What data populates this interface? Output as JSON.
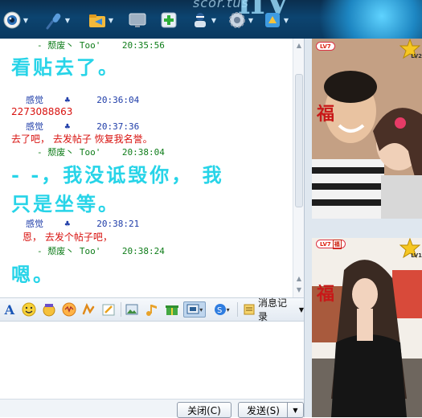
{
  "toolbar": {
    "brand_text": "scor.tus",
    "brand_big": "lIV",
    "icons": [
      "webcam-icon",
      "microphone-icon",
      "send-file-icon",
      "share-screen-icon",
      "add-app-icon",
      "remote-assist-icon",
      "settings-icon",
      "more-apps-icon"
    ]
  },
  "chat": {
    "messages": [
      {
        "type": "header",
        "color": "green",
        "sender": "-  颓废丶 Too'",
        "time": "20:35:56"
      },
      {
        "type": "big",
        "text": "看贴去了。"
      },
      {
        "type": "header",
        "color": "blue",
        "sender": "感觉",
        "time": "20:36:04"
      },
      {
        "type": "red",
        "text": "2273088863"
      },
      {
        "type": "header",
        "color": "blue",
        "sender": "感觉",
        "time": "20:37:36"
      },
      {
        "type": "red",
        "text": "去了吧， 去发帖子 恢复我名誉。"
      },
      {
        "type": "header",
        "color": "green",
        "sender": "-  颓废丶 Too'",
        "time": "20:38:04"
      },
      {
        "type": "big",
        "text": "- -，我没诋毁你，  我"
      },
      {
        "type": "big",
        "text": "只是坐等。"
      },
      {
        "type": "header",
        "color": "blue",
        "sender": "感觉",
        "time": "20:38:21"
      },
      {
        "type": "red",
        "text": "恩， 去发个帖子吧，"
      },
      {
        "type": "header",
        "color": "green",
        "sender": "-  颓废丶 Too'",
        "time": "20:38:24"
      },
      {
        "type": "big",
        "text": "嗯。"
      }
    ]
  },
  "format_bar": {
    "font_label": "A",
    "message_record_label": "消息记录"
  },
  "buttons": {
    "close_label": "关闭(C)",
    "send_label": "发送(S)"
  },
  "profile": {
    "top": {
      "level": "LV7",
      "level_small": "LV2",
      "badge": "福"
    },
    "bottom": {
      "level": "LV7",
      "level_small": "LV1",
      "badge": "福"
    }
  },
  "colors": {
    "big_text": "#27d4e8",
    "red_text": "#d8120f",
    "green_header": "#0f7d1a",
    "blue_header": "#1e3ca8"
  }
}
